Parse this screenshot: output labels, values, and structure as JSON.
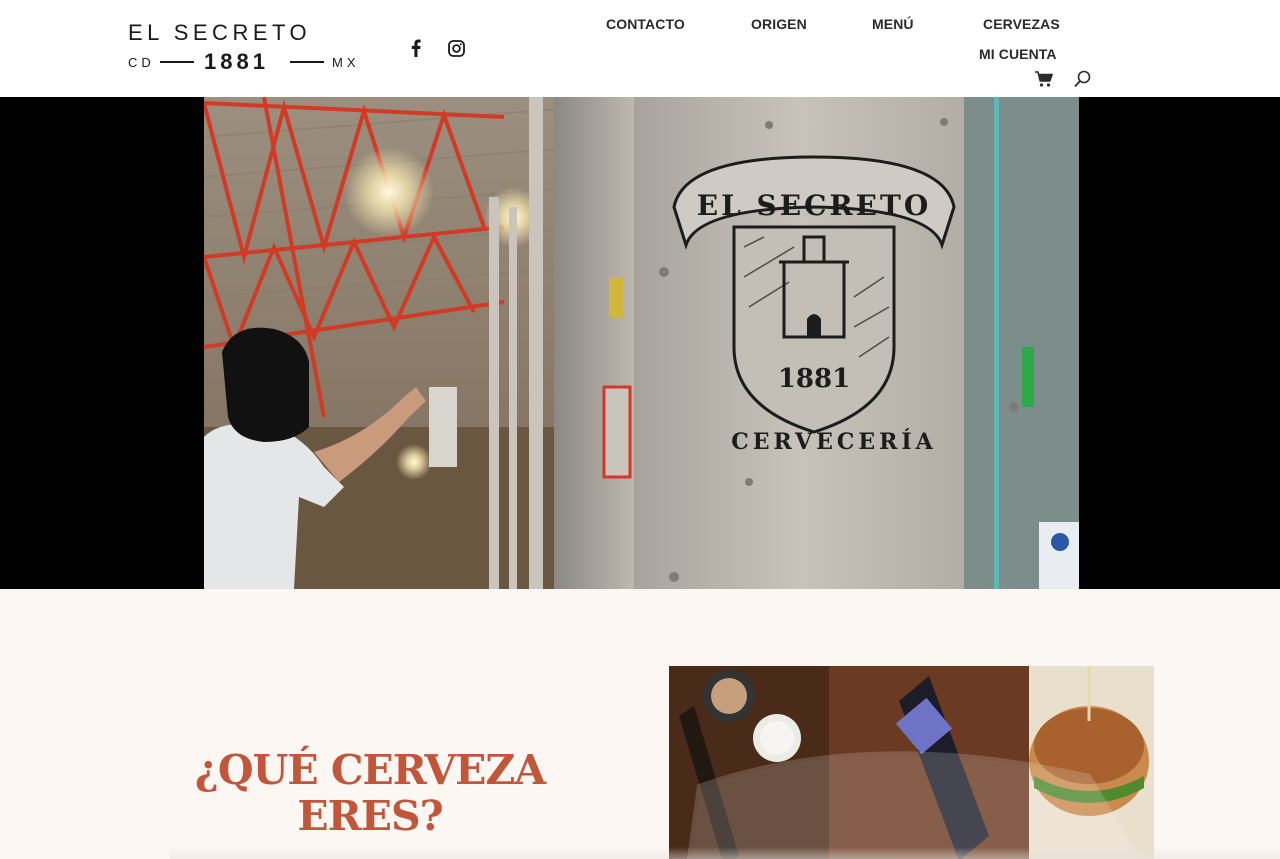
{
  "header": {
    "logo": {
      "line1": "EL SECRETO",
      "left": "CD",
      "year": "1881",
      "right": "MX"
    },
    "social": [
      {
        "name": "facebook-icon"
      },
      {
        "name": "instagram-icon"
      }
    ],
    "nav": {
      "contacto": "CONTACTO",
      "origen": "ORIGEN",
      "menu": "MENÚ",
      "cervezas": "CERVEZAS",
      "cuenta": "MI CUENTA"
    },
    "icons": {
      "cart": "cart-icon",
      "search": "search-icon"
    }
  },
  "hero": {
    "sign": {
      "banner": "EL SECRETO",
      "year": "1881",
      "caption": "CERVECERÍA"
    }
  },
  "section": {
    "title": "¿QUÉ CERVEZA ERES?"
  },
  "colors": {
    "accent": "#c2563a",
    "background": "#fcf7f2",
    "text": "#2b2b2b"
  }
}
